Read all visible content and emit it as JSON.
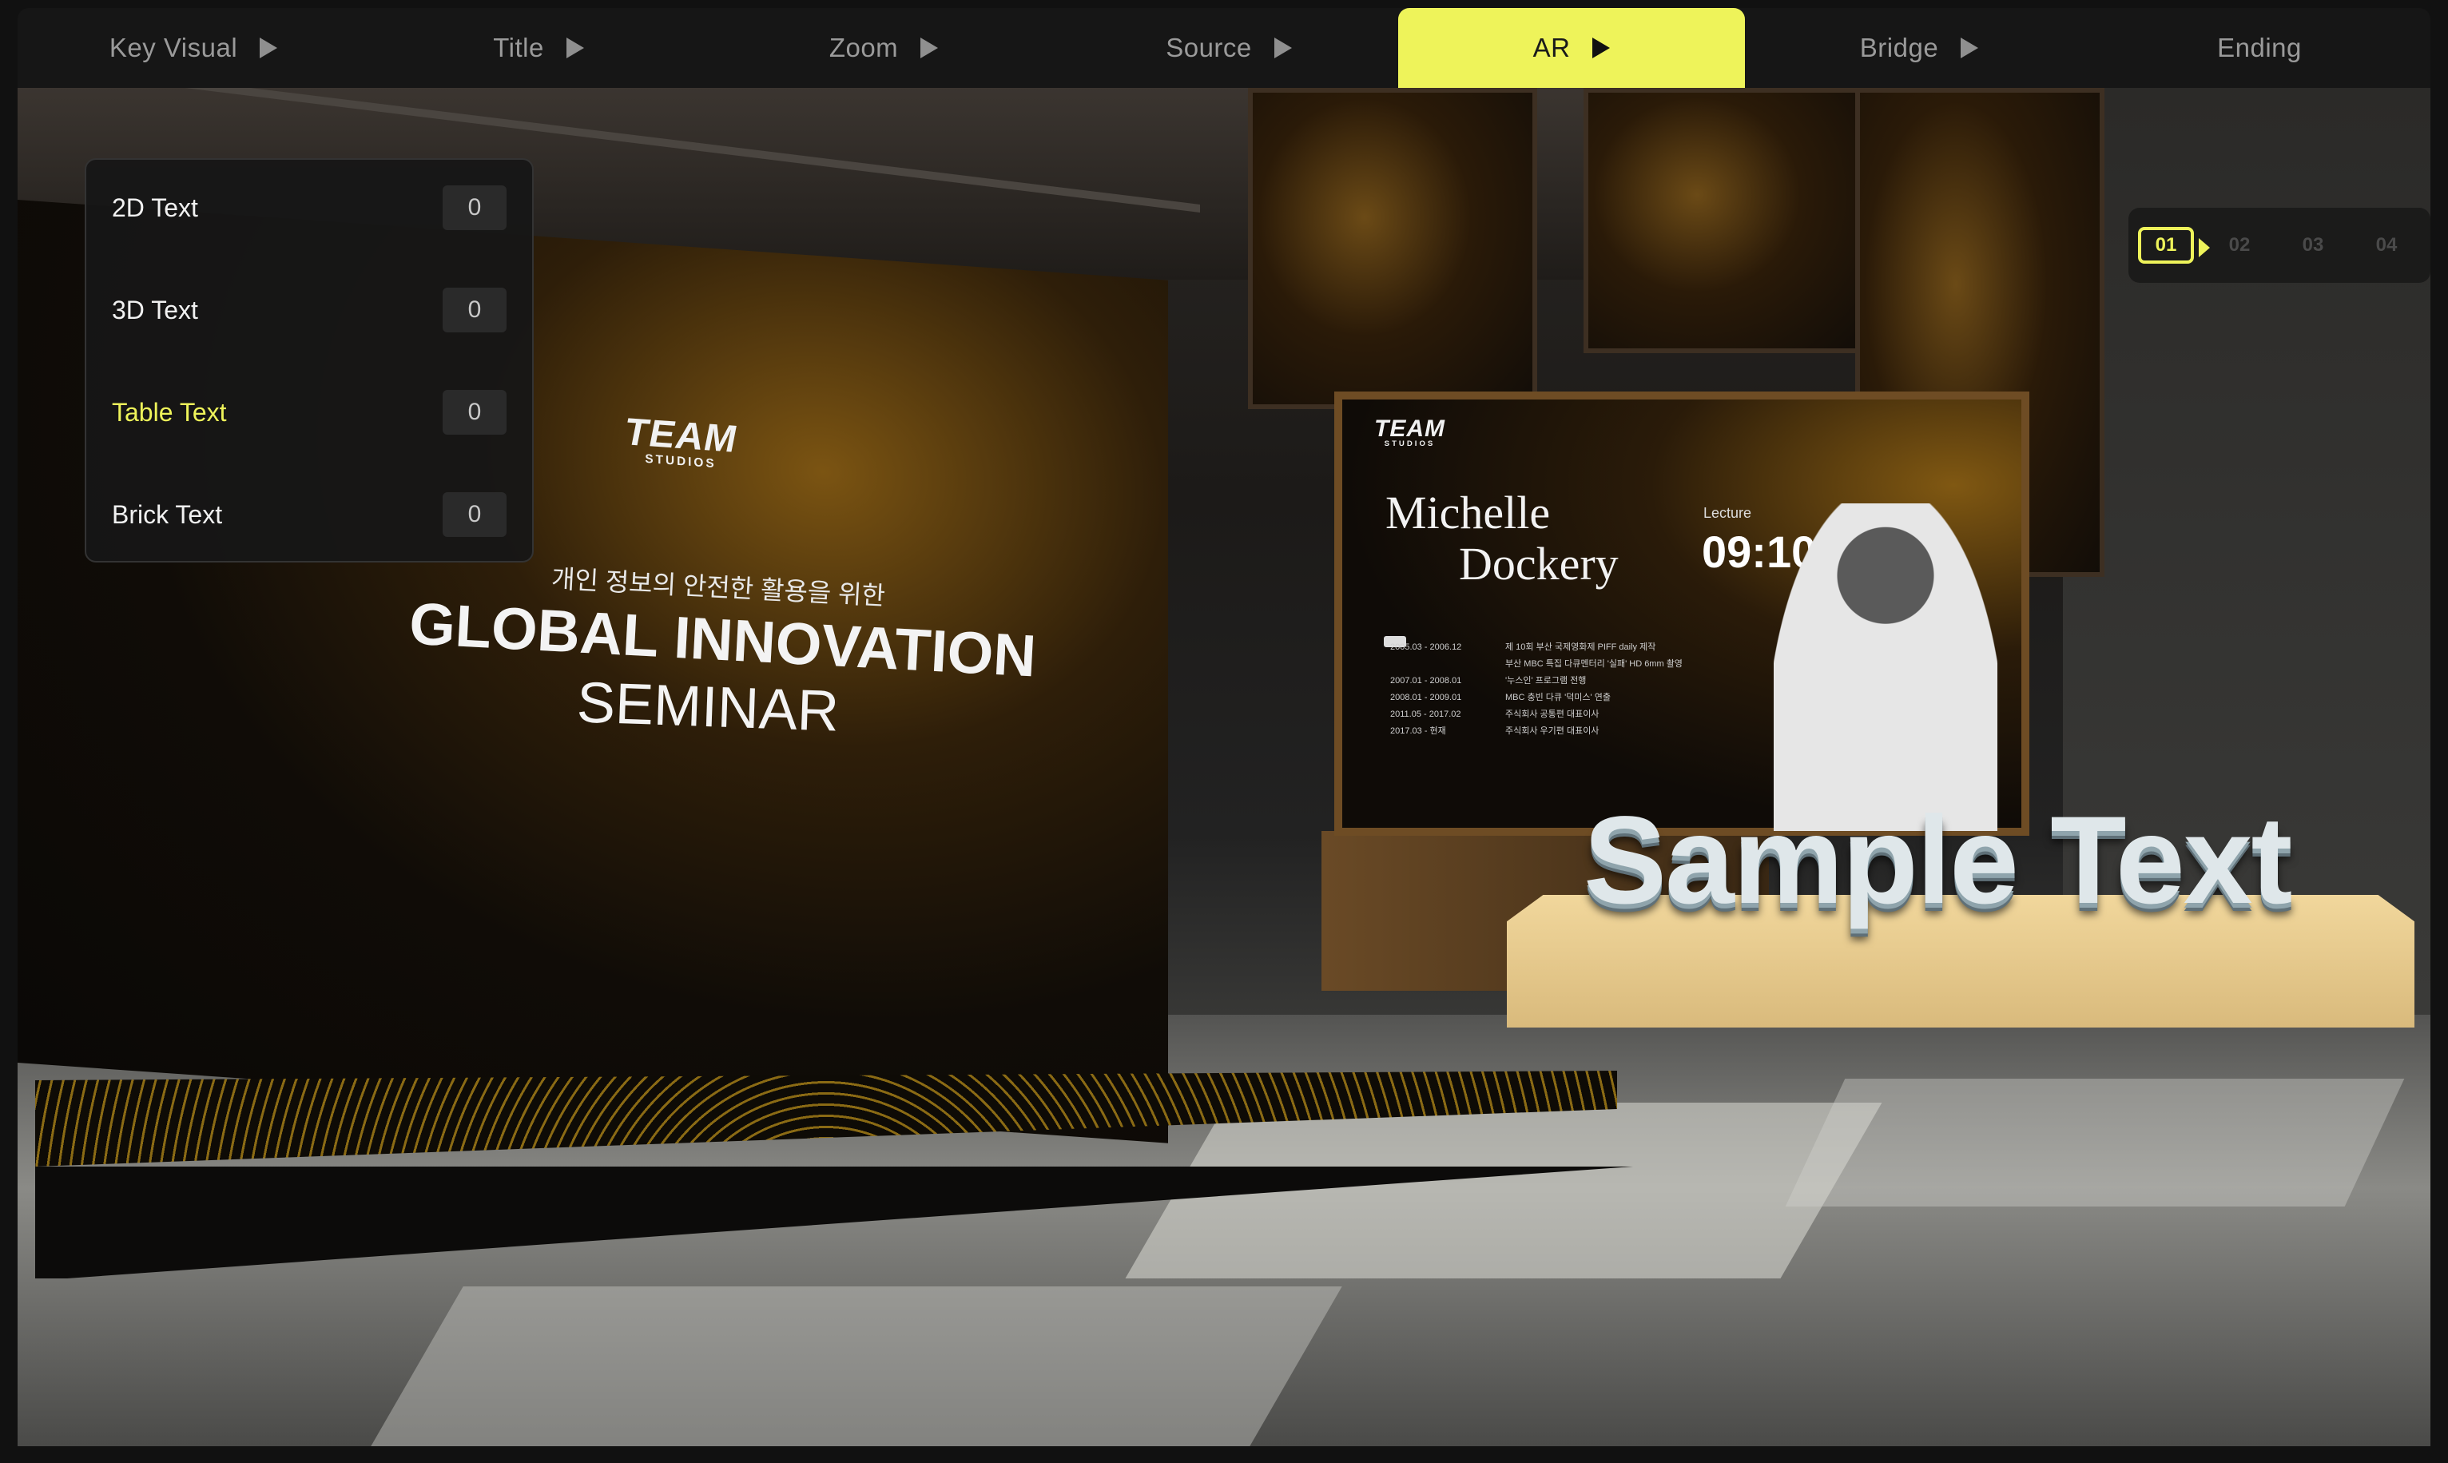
{
  "nav": {
    "tabs": [
      {
        "label": "Key Visual"
      },
      {
        "label": "Title"
      },
      {
        "label": "Zoom"
      },
      {
        "label": "Source"
      },
      {
        "label": "AR"
      },
      {
        "label": "Bridge"
      },
      {
        "label": "Ending"
      }
    ],
    "active_tab": "AR",
    "accent_color": "#eef35a"
  },
  "text_panel": {
    "items": [
      {
        "label": "2D Text",
        "value": "0"
      },
      {
        "label": "3D Text",
        "value": "0"
      },
      {
        "label": "Table Text",
        "value": "0"
      },
      {
        "label": "Brick Text",
        "value": "0"
      }
    ],
    "active_item": "Table Text"
  },
  "camera_selector": {
    "cameras": [
      "01",
      "02",
      "03",
      "04"
    ],
    "active": "01",
    "icon": "video-camera-icon"
  },
  "scene": {
    "main_screen": {
      "logo": "TEAM",
      "logo_sub": "STUDIOS",
      "korean_line": "개인 정보의 안전한 활용을 위한",
      "title_line1": "GLOBAL INNOVATION",
      "title_line2": "SEMINAR"
    },
    "side_screen": {
      "logo": "TEAM",
      "logo_sub": "STUDIOS",
      "name_line1": "Michelle",
      "name_line2": "Dockery",
      "lecture_label": "Lecture",
      "time": "09:10",
      "timeline": [
        {
          "date": "2005.03 - 2006.12",
          "text": "제 10회 부산 국제영화제 PIFF daily 제작"
        },
        {
          "date": "",
          "text": "부산 MBC 특집 다큐멘터리 '실패' HD 6mm 촬영"
        },
        {
          "date": "2007.01 - 2008.01",
          "text": "'누스인' 프로그램 전행"
        },
        {
          "date": "2008.01 - 2009.01",
          "text": "MBC 충빈 다큐 '덕미스' 연출"
        },
        {
          "date": "2011.05 - 2017.02",
          "text": "주식회사 공통편 대표이사"
        },
        {
          "date": "2017.03 - 현재",
          "text": "주식회사 우기편 대표이사"
        }
      ]
    },
    "ar_text": "Sample Text"
  }
}
